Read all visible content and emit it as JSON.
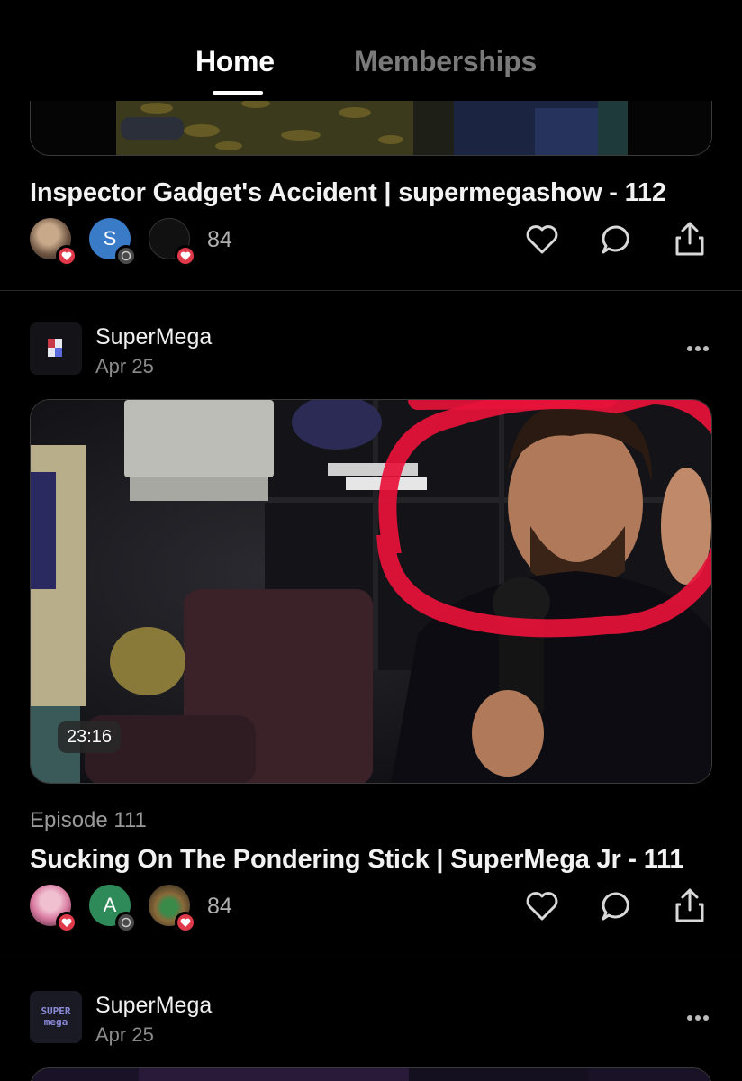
{
  "tabs": [
    {
      "label": "Home",
      "active": true
    },
    {
      "label": "Memberships",
      "active": false
    }
  ],
  "posts": [
    {
      "title": "Inspector Gadget's Accident | supermegashow - 112",
      "reaction_count": "84",
      "avatars": [
        {
          "type": "photo",
          "badge": "heart-icon"
        },
        {
          "type": "initial",
          "initial": "S",
          "color": "#3a7bc8",
          "badge": "comment-icon"
        },
        {
          "type": "photo-dark",
          "badge": "heart-icon"
        }
      ]
    },
    {
      "creator": "SuperMega",
      "date": "Apr 25",
      "duration": "23:16",
      "episode": "Episode 111",
      "title": "Sucking On The Pondering Stick | SuperMega Jr - 111",
      "reaction_count": "84",
      "avatars": [
        {
          "type": "photo-pink",
          "badge": "heart-icon"
        },
        {
          "type": "initial",
          "initial": "A",
          "color": "#2f8a5a",
          "badge": "comment-icon"
        },
        {
          "type": "photo-figure",
          "badge": "heart-icon"
        }
      ]
    },
    {
      "creator": "SuperMega",
      "date": "Apr 25",
      "logo_text": [
        "SUPER",
        "mega"
      ]
    }
  ],
  "colors": {
    "background": "#000000",
    "heart": "#e0394a",
    "highlight_scribble": "#e8123a"
  },
  "icons": [
    "heart-icon",
    "comment-icon",
    "share-icon",
    "more-icon"
  ]
}
